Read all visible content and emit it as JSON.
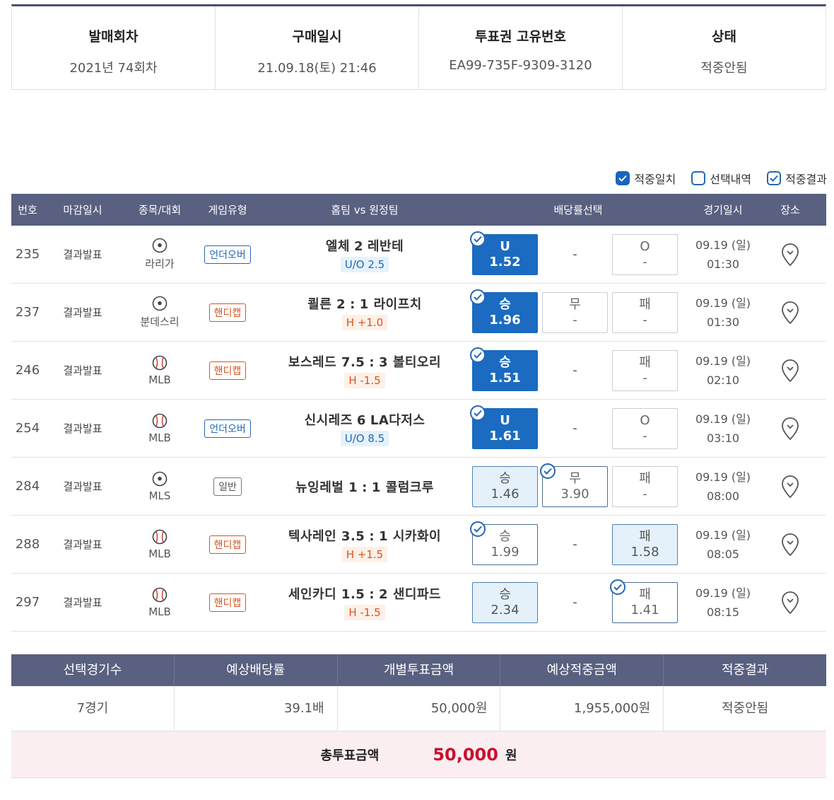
{
  "summary": {
    "round_label": "발매회차",
    "round_value": "2021년 74회차",
    "purchase_label": "구매일시",
    "purchase_value": "21.09.18(토) 21:46",
    "ticket_label": "투표권 고유번호",
    "ticket_value": "EA99-735F-9309-3120",
    "status_label": "상태",
    "status_value": "적중안됨"
  },
  "legend": {
    "match": "적중일치",
    "selection": "선택내역",
    "result": "적중결과"
  },
  "table": {
    "headers": {
      "no": "번호",
      "close": "마감일시",
      "sport": "종목/대회",
      "type": "게임유형",
      "match": "홈팀 vs 원정팀",
      "odds": "배당률선택",
      "date": "경기일시",
      "place": "장소"
    },
    "rows": [
      {
        "no": "235",
        "close": "결과발표",
        "sport": "soccer-ball-icon",
        "league": "라리가",
        "type": "언더오버",
        "home": "엘체",
        "score": "2",
        "away": "레반테",
        "handicap": "U/O 2.5",
        "o1": "U",
        "o1v": "1.52",
        "o2": "-",
        "o3": "O",
        "o3v": "-",
        "date": "09.19 (일)",
        "time": "01:30"
      },
      {
        "no": "237",
        "close": "결과발표",
        "sport": "soccer-ball-icon",
        "league": "분데스리",
        "type": "핸디캡",
        "home": "쾰른 2",
        "score": ":",
        "away": "1 라이프치",
        "handicap": "H +1.0",
        "o1": "승",
        "o1v": "1.96",
        "o2": "무",
        "o2v": "-",
        "o3": "패",
        "o3v": "-",
        "date": "09.19 (일)",
        "time": "01:30"
      },
      {
        "no": "246",
        "close": "결과발표",
        "sport": "baseball-icon",
        "league": "MLB",
        "type": "핸디캡",
        "home": "보스레드 7.5",
        "score": ":",
        "away": "3 볼티오리",
        "handicap": "H -1.5",
        "o1": "승",
        "o1v": "1.51",
        "o2": "-",
        "o3": "패",
        "o3v": "-",
        "date": "09.19 (일)",
        "time": "02:10"
      },
      {
        "no": "254",
        "close": "결과발표",
        "sport": "baseball-icon",
        "league": "MLB",
        "type": "언더오버",
        "home": "신시레즈",
        "score": "6",
        "away": "LA다저스",
        "handicap": "U/O 8.5",
        "o1": "U",
        "o1v": "1.61",
        "o2": "-",
        "o3": "O",
        "o3v": "-",
        "date": "09.19 (일)",
        "time": "03:10"
      },
      {
        "no": "284",
        "close": "결과발표",
        "sport": "soccer-ball-icon",
        "league": "MLS",
        "type": "일반",
        "home": "뉴잉레벌 1",
        "score": ":",
        "away": "1 콜럼크루",
        "handicap": "",
        "o1": "승",
        "o1v": "1.46",
        "o2": "무",
        "o2v": "3.90",
        "o3": "패",
        "o3v": "-",
        "date": "09.19 (일)",
        "time": "08:00"
      },
      {
        "no": "288",
        "close": "결과발표",
        "sport": "baseball-icon",
        "league": "MLB",
        "type": "핸디캡",
        "home": "텍사레인 3.5",
        "score": ":",
        "away": "1 시카화이",
        "handicap": "H +1.5",
        "o1": "승",
        "o1v": "1.99",
        "o2": "-",
        "o3": "패",
        "o3v": "1.58",
        "date": "09.19 (일)",
        "time": "08:05"
      },
      {
        "no": "297",
        "close": "결과발표",
        "sport": "baseball-icon",
        "league": "MLB",
        "type": "핸디캡",
        "home": "세인카디 1.5",
        "score": ":",
        "away": "2 샌디파드",
        "handicap": "H -1.5",
        "o1": "승",
        "o1v": "2.34",
        "o2": "-",
        "o3": "패",
        "o3v": "1.41",
        "date": "09.19 (일)",
        "time": "08:15"
      }
    ]
  },
  "bottom": {
    "h1": "선택경기수",
    "h2": "예상배당률",
    "h3": "개별투표금액",
    "h4": "예상적중금액",
    "h5": "적중결과",
    "v1": "7경기",
    "v2": "39.1배",
    "v3": "50,000원",
    "v4": "1,955,000원",
    "v5": "적중안됨",
    "total_label": "총투표금액",
    "total_amount": "50,000",
    "total_unit": "원"
  },
  "colors": {
    "header_bg": "#596080",
    "selected_blue": "#1b6bc1",
    "accent_red": "#c8102e"
  }
}
